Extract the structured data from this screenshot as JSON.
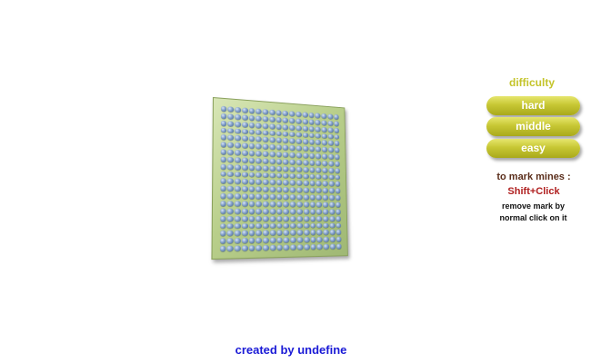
{
  "board": {
    "columns": 18,
    "rows": 20,
    "cell_color": "#6f8cba",
    "frame_color": "#b9cf8b"
  },
  "difficulty": {
    "title": "difficulty",
    "title_color": "#c4c42a",
    "buttons": [
      {
        "label": "hard"
      },
      {
        "label": "middle"
      },
      {
        "label": "easy"
      }
    ],
    "button_color": "#c7c734"
  },
  "instructions": {
    "mark_title": "to mark mines :",
    "mark_keys": "Shift+Click",
    "remove_text": "remove mark by normal click on it"
  },
  "footer": {
    "credit": "created by undefine",
    "credit_color": "#1a1ad6"
  }
}
